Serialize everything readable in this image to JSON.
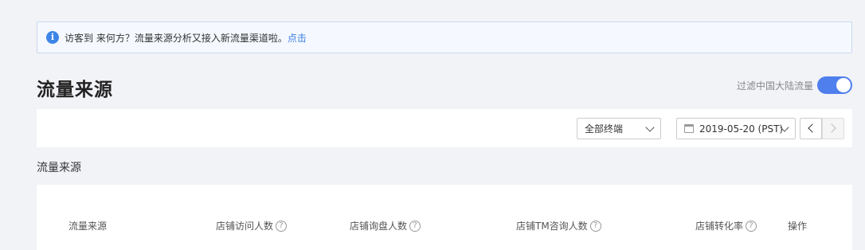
{
  "notice": {
    "icon": "info-icon",
    "text": "访客到 来何方？流量来源分析又接入新流量渠道啦。",
    "link": "点击"
  },
  "page": {
    "title": "流量来源"
  },
  "filter": {
    "label": "过滤中国大陆流量",
    "enabled": true
  },
  "toolbar": {
    "terminal_select": "全部终端",
    "date_select": "2019-05-20 (PST)"
  },
  "section": {
    "title": "流量来源"
  },
  "table": {
    "columns": [
      {
        "label": "流量来源",
        "help": false
      },
      {
        "label": "店铺访问人数",
        "help": true
      },
      {
        "label": "店铺询盘人数",
        "help": true
      },
      {
        "label": "店铺TM咨询人数",
        "help": true
      },
      {
        "label": "店铺转化率",
        "help": true
      },
      {
        "label": "操作",
        "help": false
      }
    ],
    "help_glyph": "?"
  },
  "colors": {
    "accent": "#4f7fec",
    "link": "#3b7ddd",
    "info": "#3d85e6"
  }
}
